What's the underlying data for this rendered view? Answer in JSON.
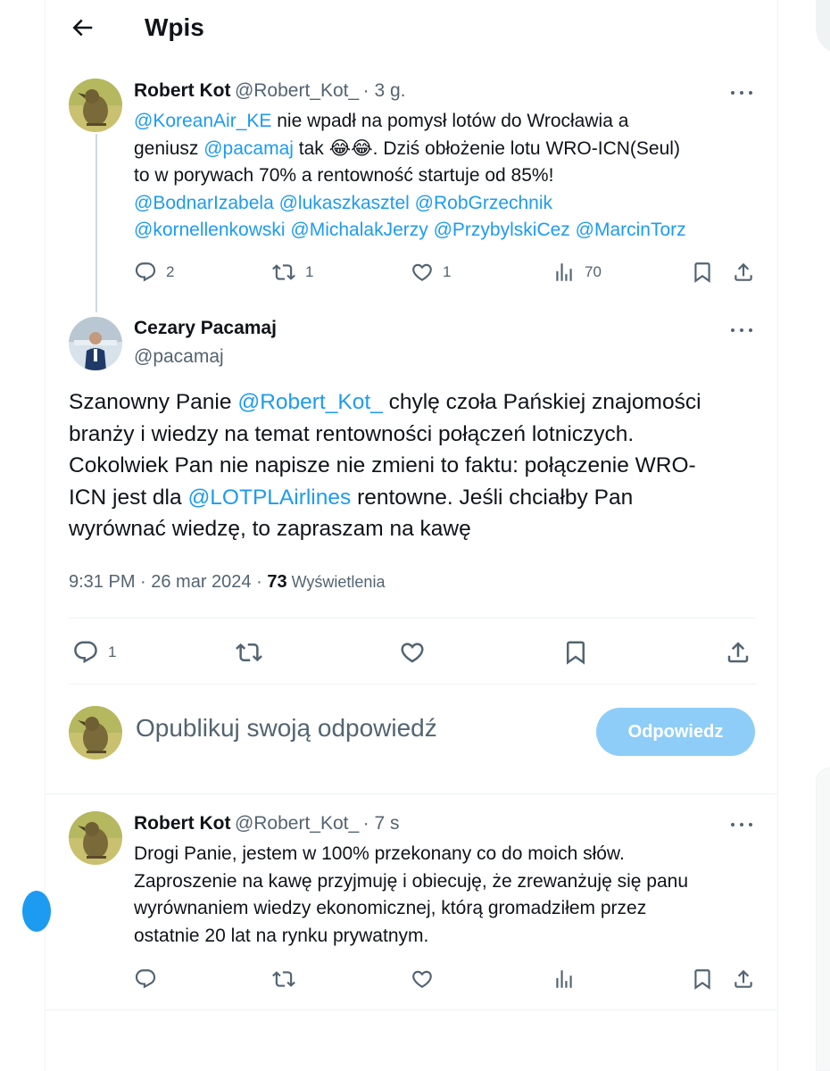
{
  "header": {
    "title": "Wpis"
  },
  "tweet1": {
    "name": "Robert Kot",
    "handle": "@Robert_Kot_",
    "time": "· 3 g.",
    "mention_korean": "@KoreanAir_KE",
    "text_a": " nie wpadł na pomysł lotów do Wrocławia a",
    "text_b": "geniusz ",
    "mention_pacamaj": "@pacamaj",
    "text_c": " tak 😂😂. Dziś obłożenie lotu WRO-ICN(Seul)",
    "text_d": "to w porywach 70% a rentowność startuje od 85%!",
    "mentions_line1": [
      "@BodnarIzabela",
      "@lukaszkasztel",
      "@RobGrzechnik"
    ],
    "mentions_line2": [
      "@kornellenkowski",
      "@MichalakJerzy",
      "@PrzybylskiCez",
      "@MarcinTorz"
    ],
    "stats": {
      "replies": "2",
      "retweets": "1",
      "likes": "1",
      "views": "70"
    }
  },
  "main": {
    "name": "Cezary Pacamaj",
    "handle": "@pacamaj",
    "line1_a": "Szanowny Panie ",
    "line1_mention": "@Robert_Kot_",
    "line1_b": "  chylę czoła Pańskiej znajomości",
    "line2": "branży i wiedzy na temat rentowności połączeń lotniczych.",
    "line3": "Cokolwiek Pan nie napisze nie zmieni to faktu: połączenie WRO-",
    "line4_a": "ICN jest dla ",
    "line4_mention": "@LOTPLAirlines",
    "line4_b": "  rentowne. Jeśli chciałby Pan",
    "line5": "wyrównać wiedzę, to zapraszam na kawę",
    "timestamp": "9:31 PM · 26 mar 2024 · ",
    "views_count": "73",
    "views_label": " Wyświetlenia",
    "stats": {
      "replies": "1"
    }
  },
  "reply_box": {
    "placeholder": "Opublikuj swoją odpowiedź",
    "button_label": "Odpowiedz"
  },
  "reply": {
    "name": "Robert Kot",
    "handle": "@Robert_Kot_",
    "time": "· 7 s",
    "lines": [
      "Drogi Panie, jestem w 100% przekonany co do moich słów.",
      "Zaproszenie na kawę przyjmuję i obiecuję, że zrewanżuję się panu",
      "wyrównaniem wiedzy ekonomicznej, którą gromadziłem przez",
      "ostatnie 20 lat na rynku prywatnym."
    ]
  },
  "colors": {
    "accent": "#1d9bf0",
    "muted": "#536471",
    "text": "#0f1419",
    "button_disabled": "#8ecdf8"
  },
  "icons": [
    "back-arrow-icon",
    "more-icon",
    "reply-icon",
    "retweet-icon",
    "like-icon",
    "views-icon",
    "bookmark-icon",
    "share-icon"
  ]
}
